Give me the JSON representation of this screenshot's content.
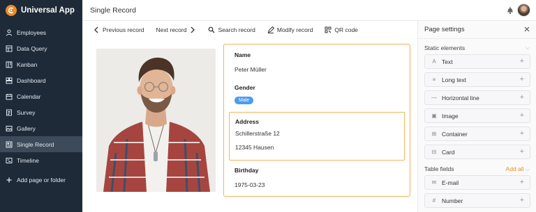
{
  "app": {
    "title": "Universal App"
  },
  "sidebar": {
    "items": [
      {
        "label": "Employees",
        "icon": "person-icon"
      },
      {
        "label": "Data Query",
        "icon": "data-query-icon"
      },
      {
        "label": "Kanban",
        "icon": "kanban-icon"
      },
      {
        "label": "Dashboard",
        "icon": "dashboard-icon"
      },
      {
        "label": "Calendar",
        "icon": "calendar-icon"
      },
      {
        "label": "Survey",
        "icon": "survey-icon"
      },
      {
        "label": "Gallery",
        "icon": "gallery-icon"
      },
      {
        "label": "Single Record",
        "icon": "single-record-icon",
        "active": true
      },
      {
        "label": "Timeline",
        "icon": "timeline-icon"
      }
    ],
    "add_label": "Add page or folder"
  },
  "header": {
    "title": "Single Record"
  },
  "toolbar": {
    "previous": "Previous record",
    "next": "Next record",
    "search": "Search record",
    "modify": "Modify record",
    "qr": "QR code"
  },
  "record": {
    "name_label": "Name",
    "name_value": "Peter Müller",
    "gender_label": "Gender",
    "gender_value": "Male",
    "address_label": "Address",
    "address_line1": "Schillerstraße 12",
    "address_line2": "12345 Hausen",
    "birthday_label": "Birthday",
    "birthday_value": "1975-03-23"
  },
  "panel": {
    "title": "Page settings",
    "static_label": "Static elements",
    "static_items": [
      {
        "label": "Text",
        "icon": "text-icon"
      },
      {
        "label": "Long text",
        "icon": "long-text-icon"
      },
      {
        "label": "Horizontal line",
        "icon": "horizontal-line-icon"
      },
      {
        "label": "Image",
        "icon": "image-icon"
      },
      {
        "label": "Container",
        "icon": "container-icon"
      },
      {
        "label": "Card",
        "icon": "card-icon"
      }
    ],
    "table_fields_label": "Table fields",
    "add_all": "Add all",
    "table_items": [
      {
        "label": "E-mail",
        "icon": "email-icon"
      },
      {
        "label": "Number",
        "icon": "number-icon"
      }
    ]
  },
  "colors": {
    "accent": "#f08a24",
    "sidebar_bg": "#1e2a38",
    "badge": "#4a9cf0",
    "highlight_border": "#f5b35d"
  }
}
